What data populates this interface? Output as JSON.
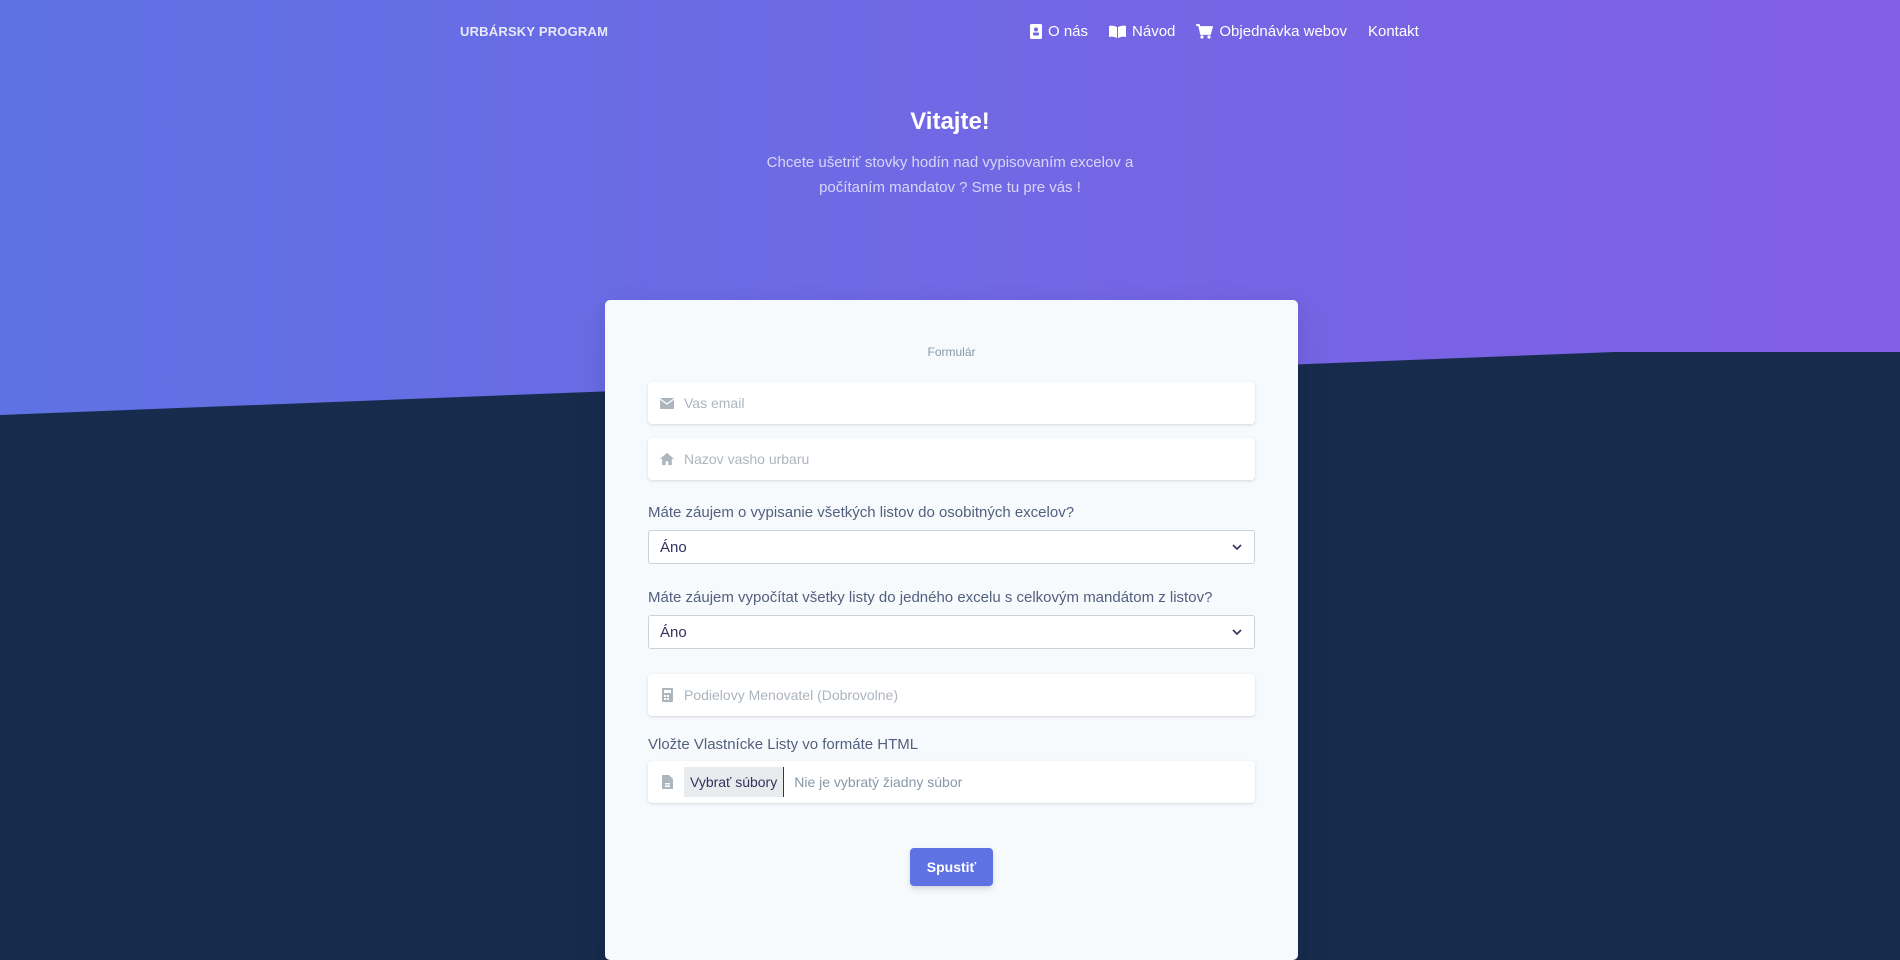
{
  "brand": "URBÁRSKY PROGRAM",
  "nav": {
    "about": "O nás",
    "guide": "Návod",
    "order": "Objednávka webov",
    "contact": "Kontakt"
  },
  "hero": {
    "title": "Vitajte!",
    "subtitle": "Chcete ušetriť stovky hodín nad vypisovaním excelov a počítaním mandatov ? Sme tu pre vás !"
  },
  "form": {
    "title": "Formulár",
    "email_placeholder": "Vas email",
    "urbar_placeholder": "Nazov vasho urbaru",
    "question1": "Máte záujem o vypisanie všetkých listov do osobitných excelov?",
    "question1_value": "Áno",
    "question2": "Máte záujem vypočítat všetky listy do jedného excelu s celkovým mandátom z listov?",
    "question2_value": "Áno",
    "denominator_placeholder": "Podielovy Menovatel (Dobrovolne)",
    "file_label": "Vložte Vlastnícke Listy vo formáte HTML",
    "file_button": "Vybrať súbory",
    "file_status": "Nie je vybratý žiadny súbor",
    "submit": "Spustiť"
  },
  "colors": {
    "gradient_start": "#5e72e4",
    "gradient_end": "#825ee4",
    "dark_bg": "#172b4d",
    "primary": "#5e72e4"
  },
  "icons": {
    "about": "address-card-icon",
    "guide": "book-icon",
    "order": "shopping-cart-icon",
    "email": "envelope-icon",
    "urbar": "home-icon",
    "denominator": "calculator-icon",
    "file": "file-icon",
    "select": "chevron-down-icon"
  }
}
